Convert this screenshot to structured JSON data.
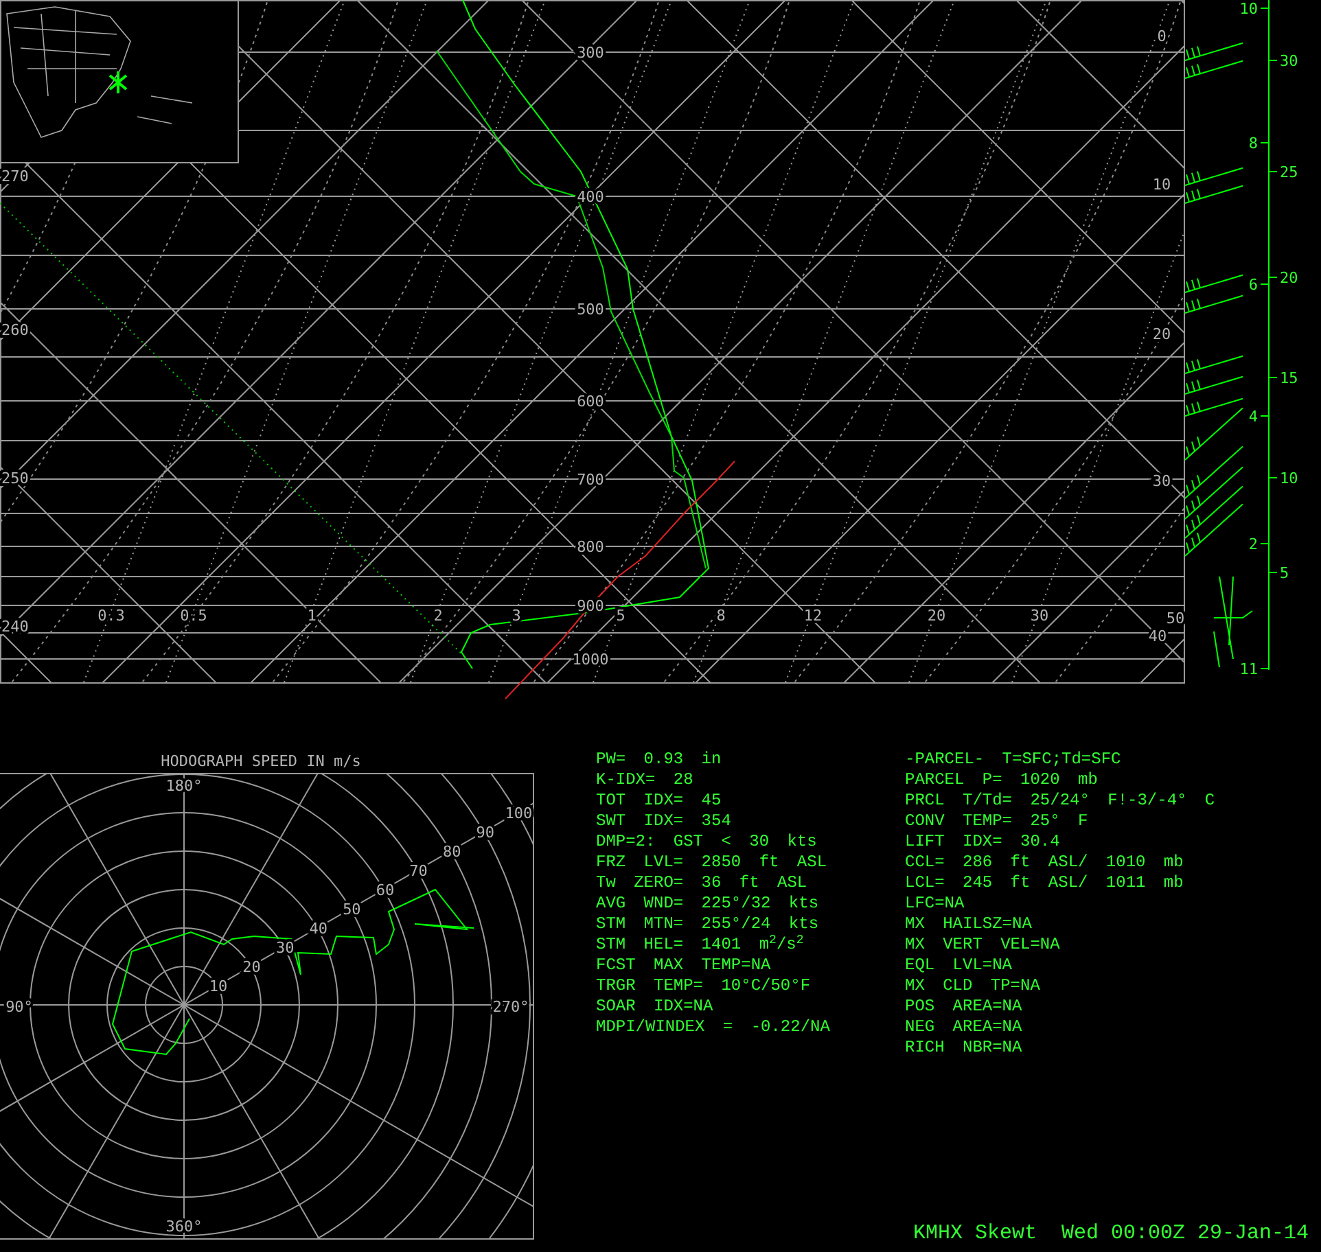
{
  "skewt": {
    "pressure_labels": [
      "300",
      "400",
      "500",
      "600",
      "700",
      "800",
      "900",
      "1000"
    ],
    "isotherm_labels": [
      "0",
      "10",
      "20",
      "30",
      "40",
      "50"
    ],
    "mixing_ratio_labels": [
      "0.3",
      "0.5",
      "1",
      "2",
      "3",
      "5",
      "8",
      "12",
      "20",
      "30"
    ],
    "theta_labels": [
      "270",
      "260",
      "250",
      "240"
    ],
    "height_km_labels": [
      "10",
      "8",
      "6",
      "4",
      "2",
      "11"
    ],
    "height_kft_labels": [
      "30",
      "25",
      "20",
      "15",
      "10",
      "5"
    ]
  },
  "hodograph": {
    "title": "HODOGRAPH SPEED IN m/s",
    "direction_labels": [
      "180°",
      "90°",
      "270°",
      "360°"
    ],
    "speed_labels": [
      "10",
      "20",
      "30",
      "40",
      "50",
      "60",
      "70",
      "80",
      "90",
      "100"
    ]
  },
  "indices": [
    "PW= 0.93 in",
    "K-IDX= 28",
    "TOT IDX= 45",
    "SWT IDX= 354",
    "DMP=2: GST < 30 kts",
    "FRZ LVL= 2850 ft ASL",
    "Tw ZERO= 36 ft ASL",
    "AVG WND= 225°/32 kts",
    "STM MTN= 255°/24 kts",
    "STM HEL= 1401 m$^{2}$/s$^{2}$",
    "FCST MAX TEMP=NA",
    "TRGR TEMP= 10°C/50°F",
    "SOAR IDX=NA",
    "MDPI/WINDEX = -0.22/NA"
  ],
  "parcel": [
    "-PARCEL- T=SFC;Td=SFC",
    "PARCEL P= 1020 mb",
    "PRCL T/Td= 25/24° F!-3/-4° C",
    "CONV TEMP= 25° F",
    "LIFT IDX= 30.4",
    "CCL= 286 ft ASL/ 1010 mb",
    "LCL= 245 ft ASL/ 1011 mb",
    "LFC=NA",
    "MX HAILSZ=NA",
    "MX VERT VEL=NA",
    "EQL LVL=NA",
    "MX CLD TP=NA",
    "POS AREA=NA",
    "NEG AREA=NA",
    "RICH NBR=NA"
  ],
  "footer": "KMHX Skewt  Wed 00:00Z 29-Jan-14"
}
